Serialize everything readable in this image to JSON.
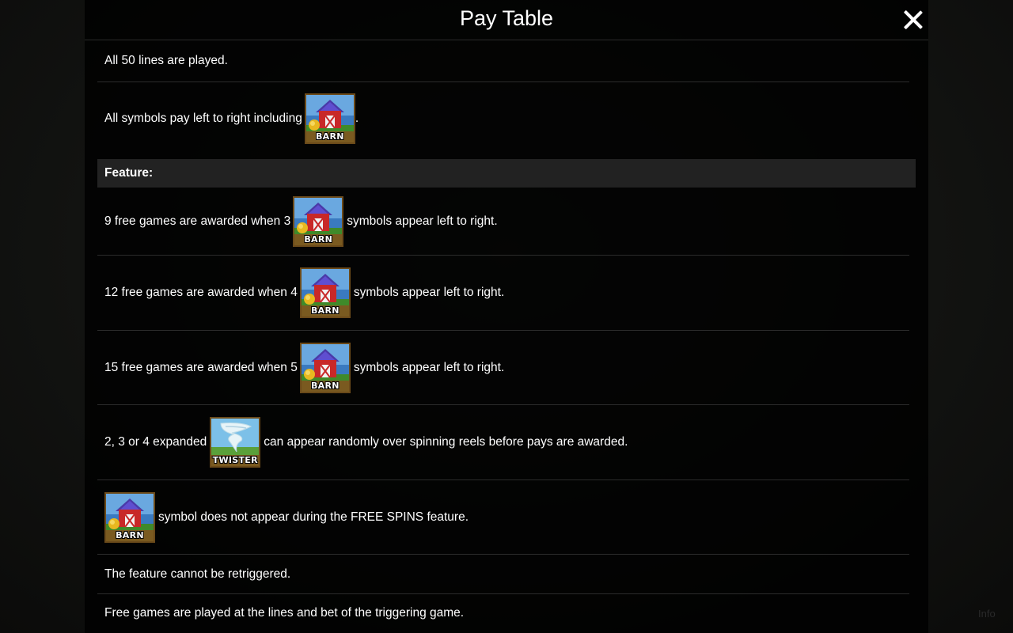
{
  "title": "Pay Table",
  "close_icon": "close-icon",
  "colors": {
    "panel": "#000000",
    "feature_header_bg": "#222222",
    "text": "#ffffff"
  },
  "rows": {
    "lines": "All 50 lines are played.",
    "pay_direction_prefix": "All symbols pay left to right including",
    "pay_direction_suffix": "."
  },
  "feature": {
    "heading": "Feature:",
    "award_3_prefix": "9 free games are awarded when 3",
    "award_4_prefix": "12 free games are awarded when 4",
    "award_5_prefix": "15 free games are awarded when 5",
    "award_suffix": "symbols appear left to right.",
    "twister_prefix": "2, 3 or 4 expanded",
    "twister_suffix": "can appear randomly over spinning reels before pays are awarded.",
    "barn_not_in_free_spins": "symbol does not appear during the FREE SPINS feature.",
    "no_retrigger": "The feature cannot be retriggered.",
    "lines_and_bet": "Free games are played at the lines and bet of the triggering game."
  },
  "symbols": {
    "barn": "BARN",
    "twister": "TWISTER"
  },
  "corner_label": "Info"
}
